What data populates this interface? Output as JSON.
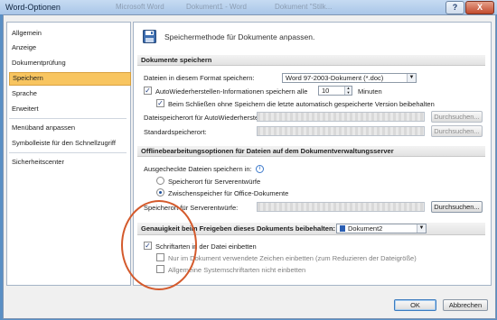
{
  "window": {
    "title": "Word-Optionen",
    "background_tabs": [
      "Microsoft Word",
      "Dokument1 - Word",
      "Dokument \"Stilk..."
    ],
    "help_label": "?",
    "close_label": "X"
  },
  "nav": {
    "items": [
      {
        "label": "Allgemein"
      },
      {
        "label": "Anzeige"
      },
      {
        "label": "Dokumentprüfung"
      },
      {
        "label": "Speichern",
        "selected": true
      },
      {
        "label": "Sprache"
      },
      {
        "label": "Erweitert"
      },
      {
        "label": "Menüband anpassen"
      },
      {
        "label": "Symbolleiste für den Schnellzugriff"
      },
      {
        "label": "Sicherheitscenter"
      }
    ],
    "selected_color": "#f8c560"
  },
  "panel": {
    "icon": "floppy-disk-icon",
    "title": "Speichermethode für Dokumente anpassen.",
    "section_save": {
      "header": "Dokumente speichern",
      "format_label": "Dateien in diesem Format speichern:",
      "format_value": "Word 97-2003-Dokument (*.doc)",
      "autorecover_label": "AutoWiederherstellen-Informationen speichern alle",
      "autorecover_checked": true,
      "autorecover_minutes": "10",
      "minutes_label": "Minuten",
      "keep_last_label": "Beim Schließen ohne Speichern die letzte automatisch gespeicherte Version beibehalten",
      "keep_last_checked": true,
      "autorecover_path_label": "Dateispeicherort für AutoWiederherstellen:",
      "default_path_label": "Standardspeicherort:",
      "browse_label": "Durchsuchen..."
    },
    "section_offline": {
      "header": "Offlinebearbeitungsoptionen für Dateien auf dem Dokumentverwaltungsserver",
      "checkout_label": "Ausgecheckte Dateien speichern in:",
      "radio_server": "Speicherort für Serverentwürfe",
      "radio_cache": "Zwischenspeicher für Office-Dokumente",
      "selected_radio": "cache",
      "drafts_label": "Speicherort für Serverentwürfe:",
      "browse_label": "Durchsuchen..."
    },
    "section_fidelity": {
      "header": "Genauigkeit beim Freigeben dieses Dokuments beibehalten:",
      "document": "Dokument2",
      "embed_fonts_label": "Schriftarten in der Datei einbetten",
      "embed_fonts_checked": true,
      "embed_used_label": "Nur im Dokument verwendete Zeichen einbetten (zum Reduzieren der Dateigröße)",
      "embed_used_checked": false,
      "no_system_label": "Allgemeine Systemschriftarten nicht einbetten",
      "no_system_checked": false
    }
  },
  "footer": {
    "ok_label": "OK",
    "cancel_label": "Abbrechen"
  },
  "annotation": {
    "color": "#d45a2c"
  }
}
